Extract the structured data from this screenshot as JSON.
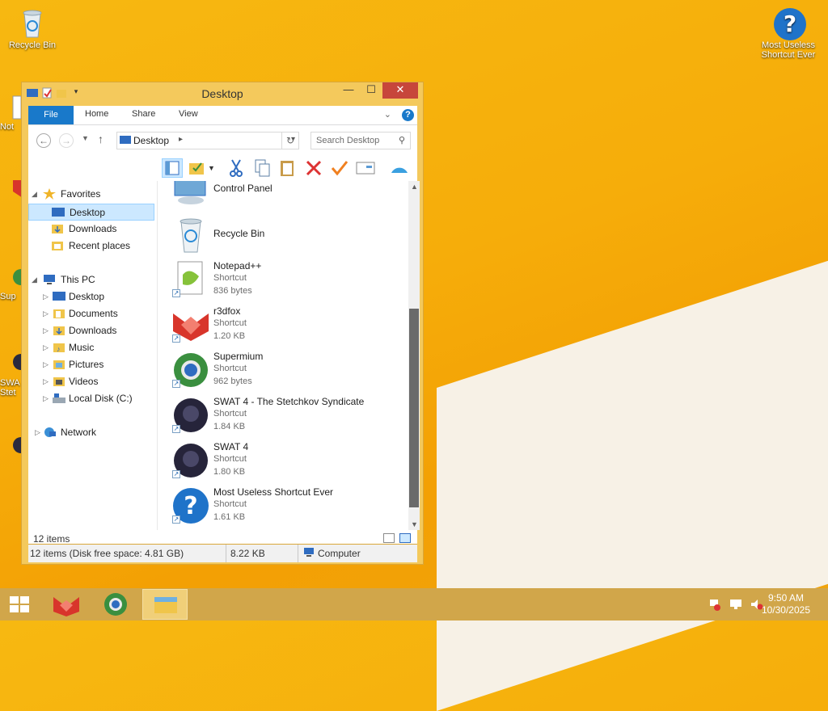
{
  "desktop": {
    "icons": [
      {
        "label": "Recycle Bin",
        "icon": "recycle-bin-icon"
      },
      {
        "label": "Most Useless Shortcut Ever",
        "icon": "question-icon"
      }
    ],
    "partial_labels": [
      "Not",
      "Sup",
      "SWA",
      "Stet"
    ]
  },
  "window": {
    "title": "Desktop",
    "controls": {
      "minimize": "—",
      "maximize": "☐",
      "close": "✕"
    },
    "ribbon": {
      "tabs": [
        "File",
        "Home",
        "Share",
        "View"
      ]
    },
    "address": {
      "location": "Desktop"
    },
    "search": {
      "placeholder": "Search Desktop"
    },
    "nav": {
      "favorites": {
        "label": "Favorites",
        "items": [
          "Desktop",
          "Downloads",
          "Recent places"
        ]
      },
      "this_pc": {
        "label": "This PC",
        "items": [
          "Desktop",
          "Documents",
          "Downloads",
          "Music",
          "Pictures",
          "Videos",
          "Local Disk (C:)"
        ]
      },
      "network": {
        "label": "Network"
      }
    },
    "files": [
      {
        "name": "Control Panel",
        "type": "",
        "size": ""
      },
      {
        "name": "Recycle Bin",
        "type": "",
        "size": ""
      },
      {
        "name": "Notepad++",
        "type": "Shortcut",
        "size": "836 bytes"
      },
      {
        "name": "r3dfox",
        "type": "Shortcut",
        "size": "1.20 KB"
      },
      {
        "name": "Supermium",
        "type": "Shortcut",
        "size": "962 bytes"
      },
      {
        "name": "SWAT 4 - The Stetchkov Syndicate",
        "type": "Shortcut",
        "size": "1.84 KB"
      },
      {
        "name": "SWAT 4",
        "type": "Shortcut",
        "size": "1.80 KB"
      },
      {
        "name": "Most Useless Shortcut Ever",
        "type": "Shortcut",
        "size": "1.61 KB"
      }
    ],
    "status": {
      "item_count": "12 items"
    },
    "bottom": {
      "disk_info": "12 items (Disk free space: 4.81 GB)",
      "size": "8.22 KB",
      "location": "Computer"
    }
  },
  "taskbar": {
    "clock": {
      "time": "9:50 AM",
      "date": "10/30/2025"
    }
  },
  "colors": {
    "accent": "#1979ca",
    "window_frame": "#f4c95c",
    "taskbar": "#d1a64a",
    "close": "#c7463b"
  }
}
